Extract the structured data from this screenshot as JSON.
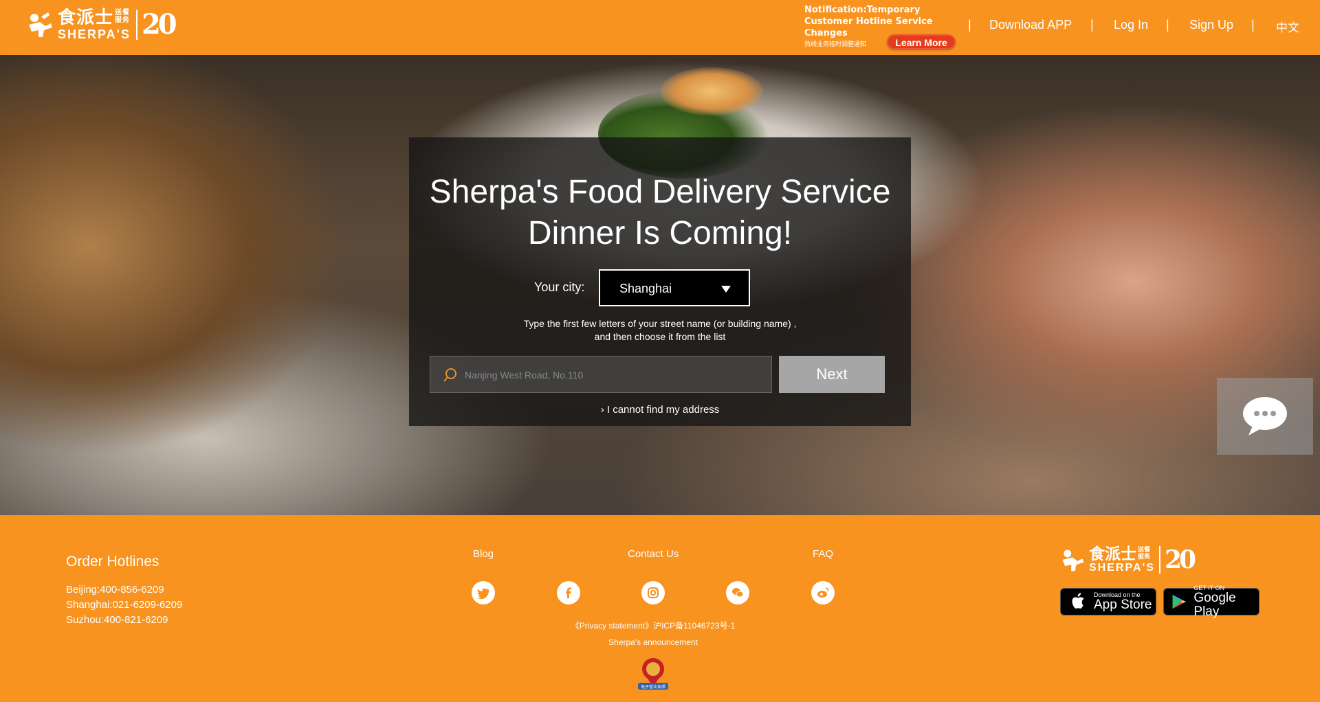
{
  "header": {
    "brand_cn": "食派士",
    "brand_cn_small": "送餐服务",
    "brand_en": "SHERPA'S",
    "anniversary": "20",
    "notice_title": "Notification:Temporary Customer Hotline Service Changes",
    "notice_cn": "热线业务临时调整通知",
    "learn_more": "Learn More",
    "nav": [
      "Download APP",
      "Log In",
      "Sign Up",
      "中文"
    ]
  },
  "hero": {
    "title_line1": "Sherpa's Food Delivery Service",
    "title_line2": "Dinner Is Coming!",
    "city_label": "Your city:",
    "city_value": "Shanghai",
    "hint_line1": "Type the first few letters of your street name (or building name) ,",
    "hint_line2": "and then choose it from the list",
    "address_placeholder": "Nanjing West Road, No.110",
    "next_label": "Next",
    "cant_find": "› I cannot find my address"
  },
  "footer": {
    "hotlines_title": "Order Hotlines",
    "hotlines": [
      "Beijing:400-856-6209",
      "Shanghai:021-6209-6209",
      "Suzhou:400-821-6209"
    ],
    "links": [
      "Blog",
      "Contact Us",
      "FAQ"
    ],
    "social_icons": [
      "twitter-icon",
      "facebook-icon",
      "instagram-icon",
      "wechat-icon",
      "weibo-icon"
    ],
    "privacy": "《Privacy statement》沪ICP备11046723号-1",
    "announcement": "Sherpa's announcement",
    "badge_caption": "电子营业执照",
    "app_store_small": "Download on the",
    "app_store_big": "App Store",
    "google_small": "GET IT ON",
    "google_big": "Google Play"
  },
  "colors": {
    "brand_orange": "#f7931e",
    "learn_more_red": "#e63b1b",
    "next_gray": "#a6a6a6"
  }
}
